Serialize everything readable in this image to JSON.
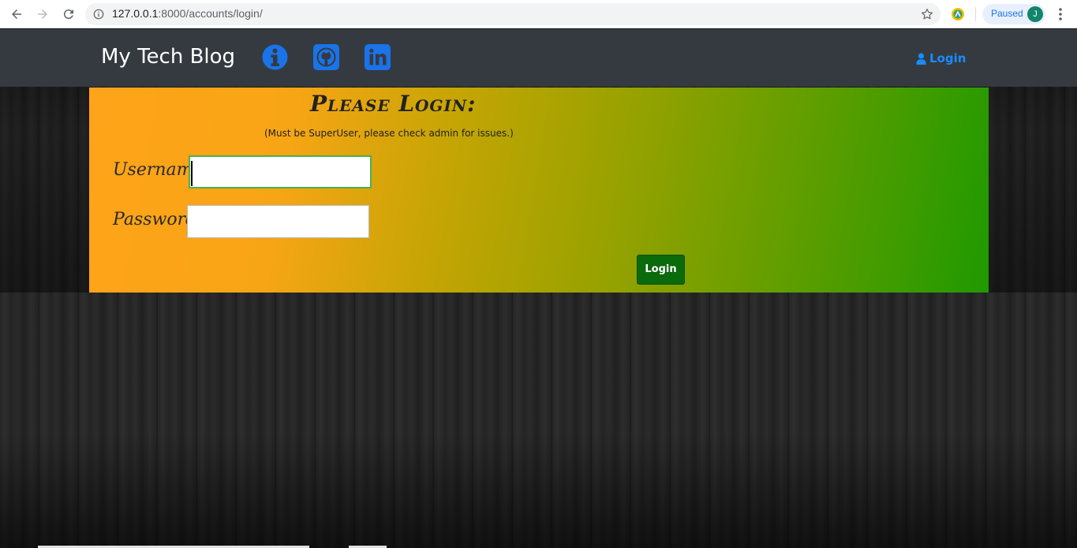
{
  "browser": {
    "url_host": "127.0.0.1",
    "url_path": ":8000/accounts/login/",
    "profile_status": "Paused",
    "profile_initial": "J"
  },
  "navbar": {
    "brand": "My Tech Blog",
    "social": [
      {
        "name": "info-icon",
        "color": "#1a73e8"
      },
      {
        "name": "github-icon",
        "color": "#1a73e8"
      },
      {
        "name": "linkedin-icon",
        "color": "#1a73e8"
      }
    ],
    "login_label": "Login",
    "login_color": "#1a8cff"
  },
  "login_form": {
    "title": "Please Login:",
    "subtitle": "(Must be SuperUser, please check admin for issues.)",
    "username_label": "Username:",
    "username_value": "",
    "password_label": "Password:",
    "password_value": "",
    "submit_label": "Login",
    "submit_color": "#0b6a0b"
  }
}
